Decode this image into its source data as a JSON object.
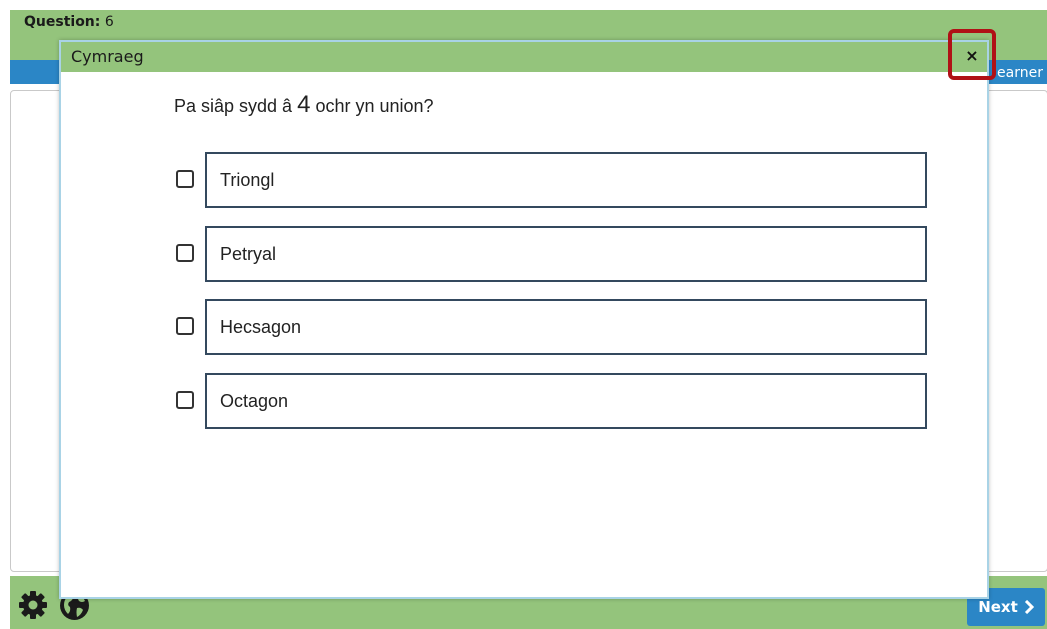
{
  "header": {
    "question_label": "Question:",
    "question_number": "6",
    "learner_tab": "earner"
  },
  "modal": {
    "title": "Cymraeg",
    "close_icon": "×",
    "prompt_before": "Pa siâp sydd â",
    "prompt_number": "4",
    "prompt_after": "ochr yn union?",
    "options": [
      {
        "label": "Triongl",
        "checked": false
      },
      {
        "label": "Petryal",
        "checked": false
      },
      {
        "label": "Hecsagon",
        "checked": false
      },
      {
        "label": "Octagon",
        "checked": false
      }
    ]
  },
  "footer": {
    "settings_icon": "gear-icon",
    "language_icon": "globe-icon",
    "next_label": "Next",
    "next_icon": "chevron-right-icon"
  },
  "colors": {
    "green": "#94c47c",
    "blue": "#2b86c6",
    "highlight": "#b01116"
  }
}
